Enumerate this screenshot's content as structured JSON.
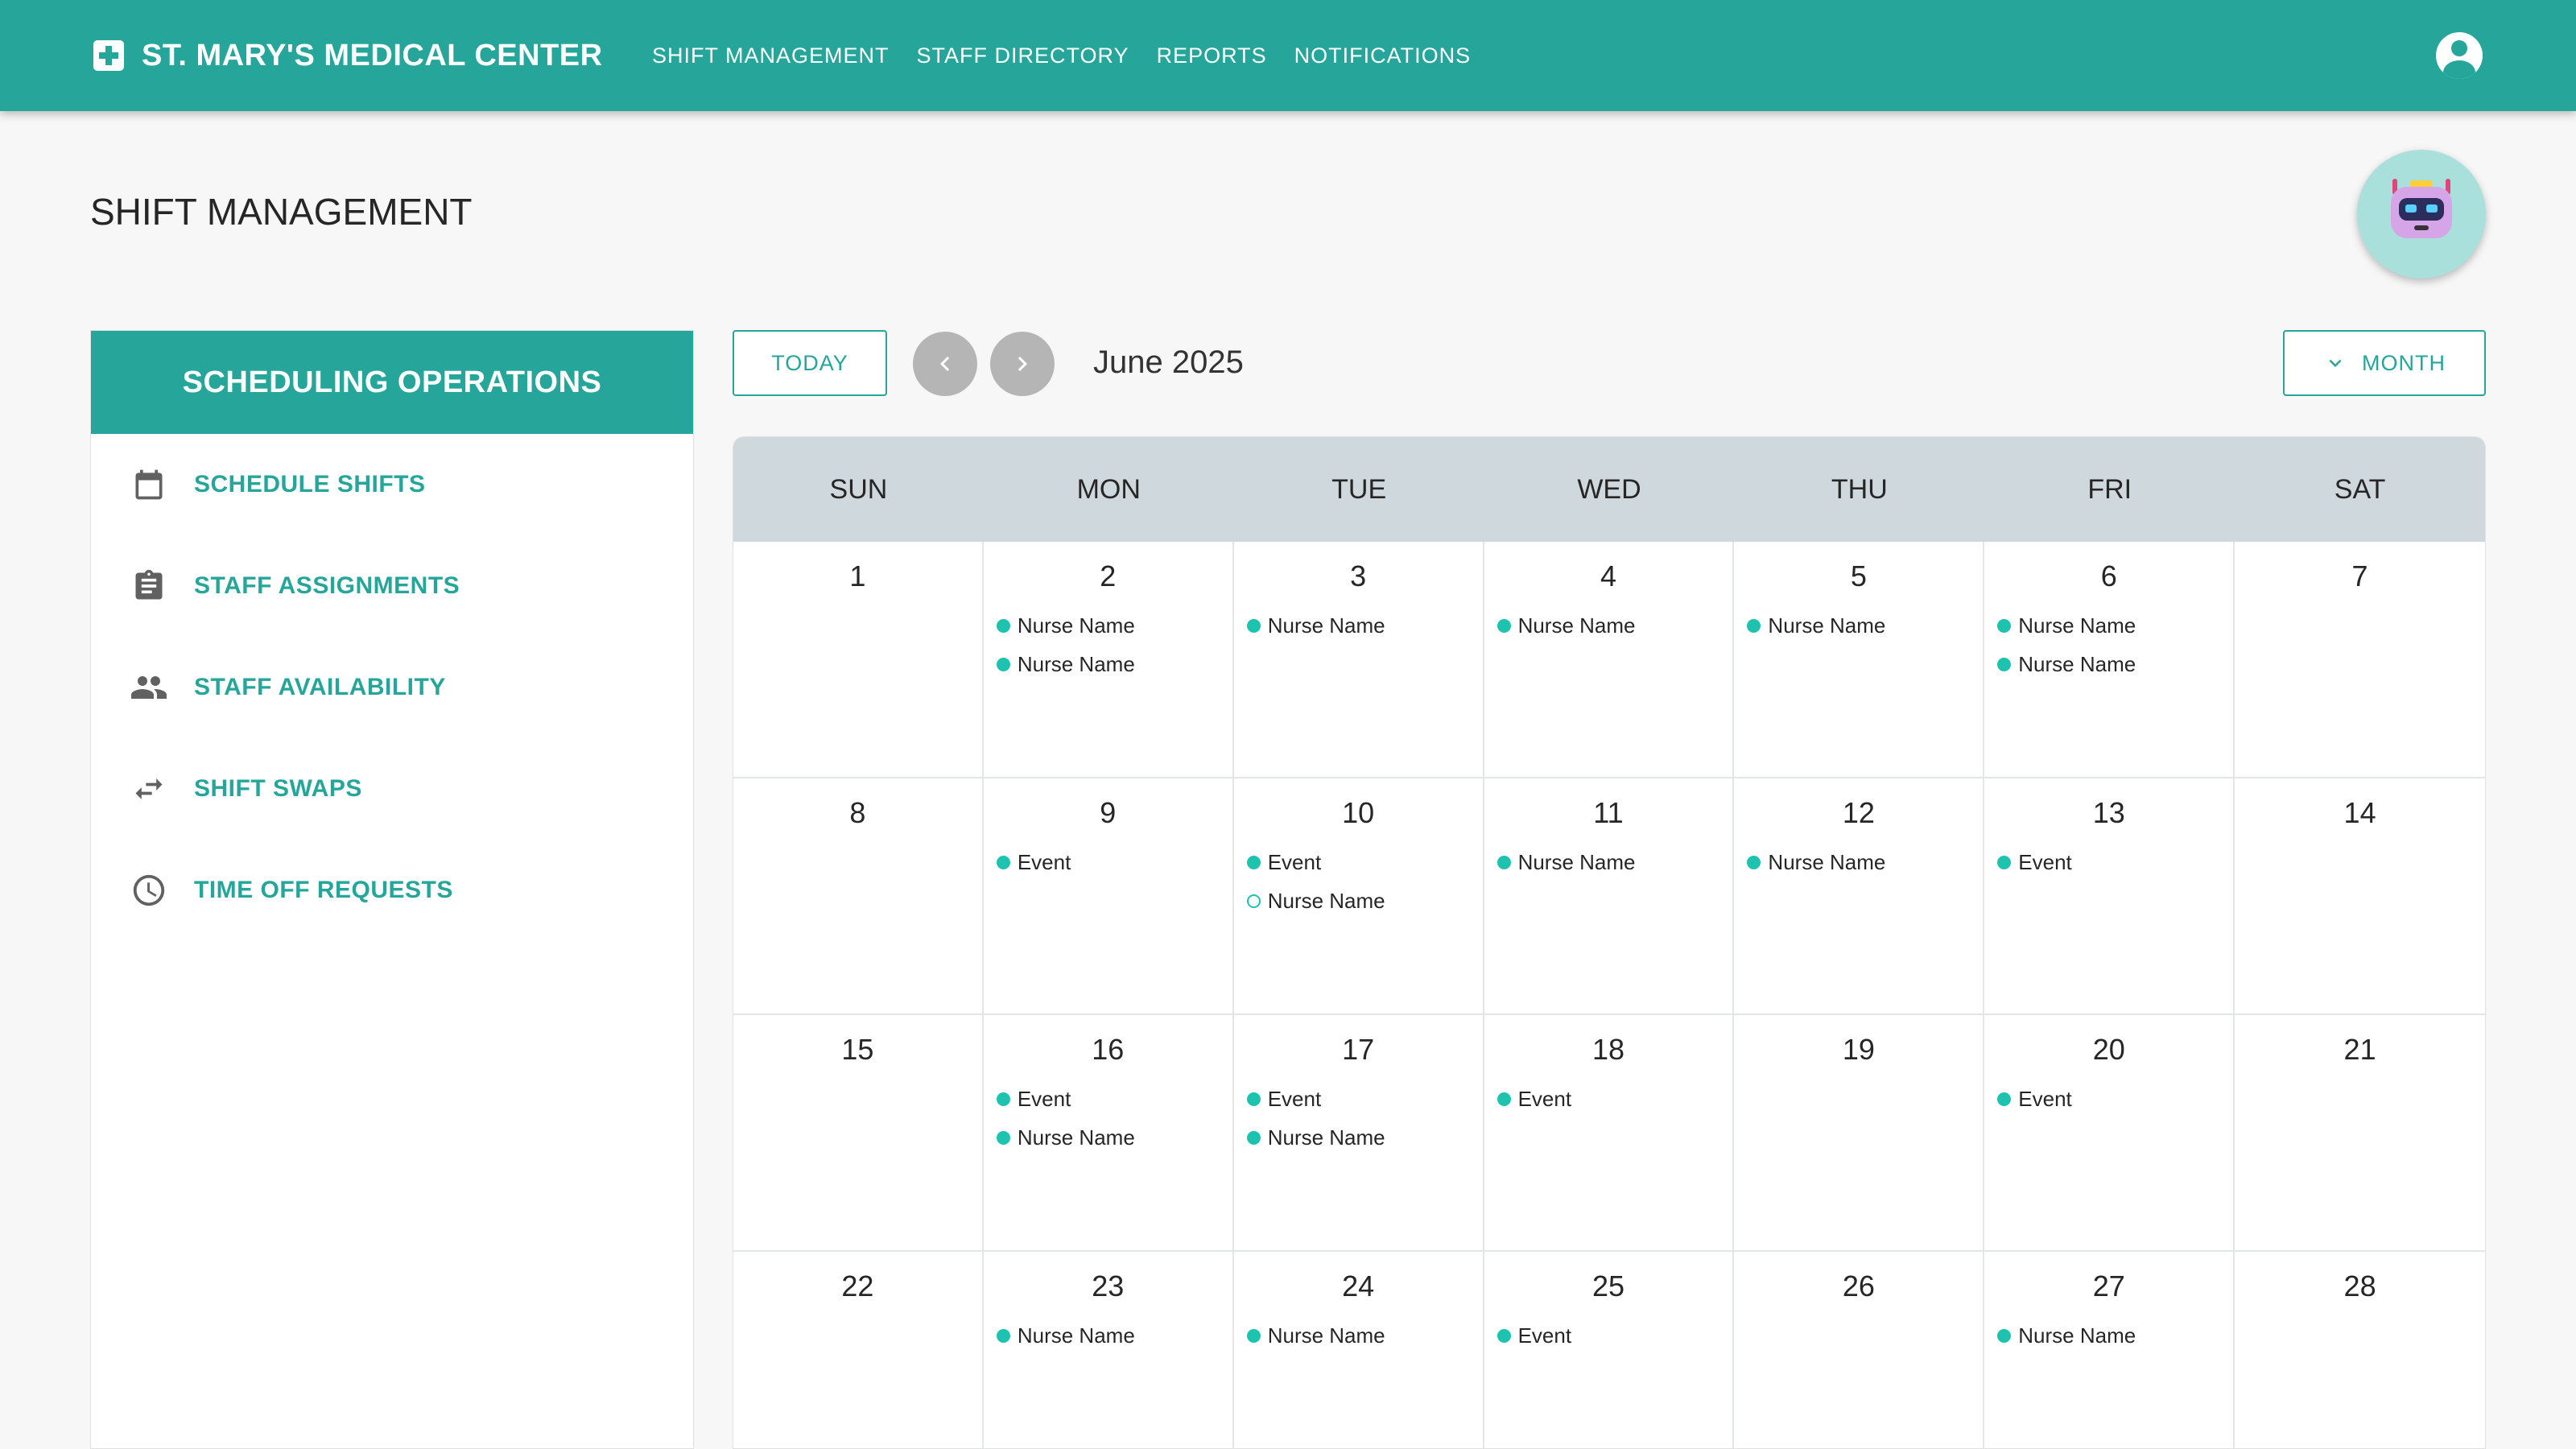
{
  "app": {
    "title": "ST. MARY'S MEDICAL CENTER",
    "nav": [
      "SHIFT MANAGEMENT",
      "STAFF DIRECTORY",
      "REPORTS",
      "NOTIFICATIONS"
    ]
  },
  "page": {
    "title": "SHIFT MANAGEMENT"
  },
  "sidebar": {
    "header": "SCHEDULING OPERATIONS",
    "items": [
      {
        "label": "SCHEDULE SHIFTS",
        "icon": "calendar-icon"
      },
      {
        "label": "STAFF ASSIGNMENTS",
        "icon": "clipboard-icon"
      },
      {
        "label": "STAFF AVAILABILITY",
        "icon": "people-icon"
      },
      {
        "label": "SHIFT SWAPS",
        "icon": "swap-icon"
      },
      {
        "label": "TIME OFF REQUESTS",
        "icon": "clock-icon"
      }
    ]
  },
  "toolbar": {
    "today_label": "TODAY",
    "month_label": "June 2025",
    "view_label": "MONTH"
  },
  "colors": {
    "accent": "#26a69a",
    "event_dot": "#1ec3b0",
    "header_bg": "#cfd8dc"
  },
  "calendar": {
    "weekdays": [
      "SUN",
      "MON",
      "TUE",
      "WED",
      "THU",
      "FRI",
      "SAT"
    ],
    "days": [
      {
        "day": "1",
        "events": []
      },
      {
        "day": "2",
        "events": [
          {
            "label": "Nurse Name"
          },
          {
            "label": "Nurse Name"
          }
        ]
      },
      {
        "day": "3",
        "events": [
          {
            "label": "Nurse Name"
          }
        ]
      },
      {
        "day": "4",
        "events": [
          {
            "label": "Nurse Name"
          }
        ]
      },
      {
        "day": "5",
        "events": [
          {
            "label": "Nurse Name"
          }
        ]
      },
      {
        "day": "6",
        "events": [
          {
            "label": "Nurse Name"
          },
          {
            "label": "Nurse Name"
          }
        ]
      },
      {
        "day": "7",
        "events": []
      },
      {
        "day": "8",
        "events": []
      },
      {
        "day": "9",
        "events": [
          {
            "label": "Event"
          }
        ]
      },
      {
        "day": "10",
        "events": [
          {
            "label": "Event"
          },
          {
            "label": "Nurse Name",
            "hollow": true
          }
        ]
      },
      {
        "day": "11",
        "events": [
          {
            "label": "Nurse Name"
          }
        ]
      },
      {
        "day": "12",
        "events": [
          {
            "label": "Nurse Name"
          }
        ]
      },
      {
        "day": "13",
        "events": [
          {
            "label": "Event"
          }
        ]
      },
      {
        "day": "14",
        "events": []
      },
      {
        "day": "15",
        "events": []
      },
      {
        "day": "16",
        "events": [
          {
            "label": "Event"
          },
          {
            "label": "Nurse Name"
          }
        ]
      },
      {
        "day": "17",
        "events": [
          {
            "label": "Event"
          },
          {
            "label": "Nurse Name"
          }
        ]
      },
      {
        "day": "18",
        "events": [
          {
            "label": "Event"
          }
        ]
      },
      {
        "day": "19",
        "events": []
      },
      {
        "day": "20",
        "events": [
          {
            "label": "Event"
          }
        ]
      },
      {
        "day": "21",
        "events": []
      },
      {
        "day": "22",
        "events": []
      },
      {
        "day": "23",
        "events": [
          {
            "label": "Nurse Name"
          }
        ]
      },
      {
        "day": "24",
        "events": [
          {
            "label": "Nurse Name"
          }
        ]
      },
      {
        "day": "25",
        "events": [
          {
            "label": "Event"
          }
        ]
      },
      {
        "day": "26",
        "events": []
      },
      {
        "day": "27",
        "events": [
          {
            "label": "Nurse Name"
          }
        ]
      },
      {
        "day": "28",
        "events": []
      }
    ]
  }
}
